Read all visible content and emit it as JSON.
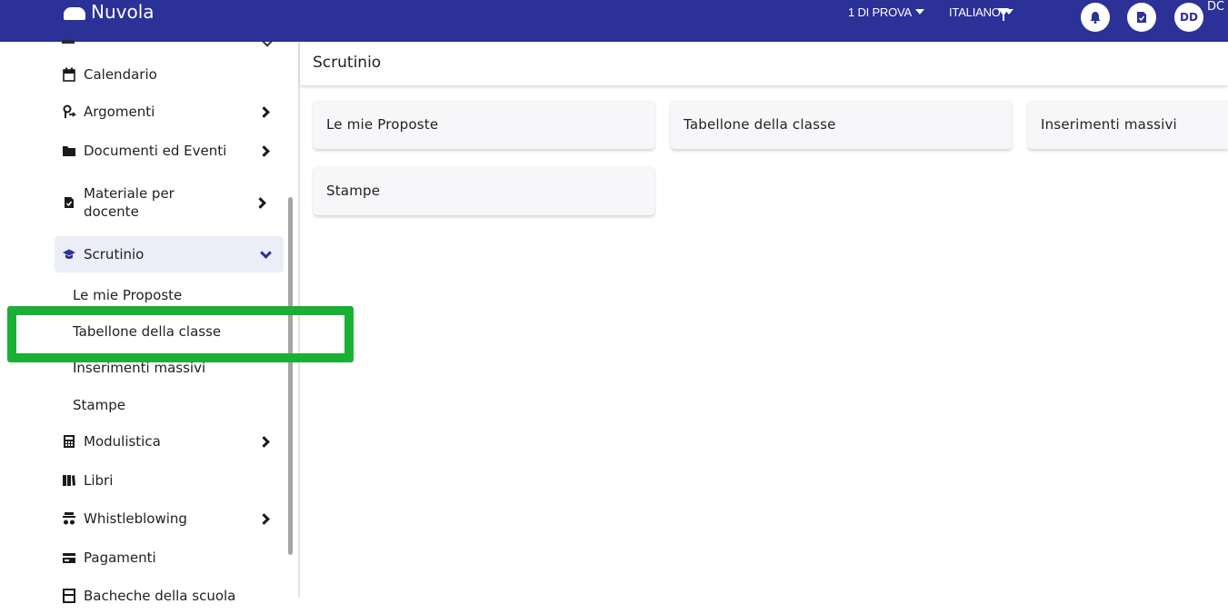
{
  "topbar": {
    "app_name": "Nuvola",
    "class_selector": "1 DI PROVA",
    "language_selector": "ITALIANO",
    "avatar_initials": "DD",
    "user_text": "DC",
    "bg_color": "#2b3196"
  },
  "sidebar": {
    "items": [
      {
        "label": "Calendario",
        "icon": "calendar-icon",
        "has_chevron": false
      },
      {
        "label": "Argomenti",
        "icon": "argomenti-icon",
        "has_chevron": true
      },
      {
        "label": "Documenti ed Eventi",
        "icon": "folder-icon",
        "has_chevron": true
      },
      {
        "label": "Materiale per docente",
        "icon": "document-icon",
        "has_chevron": true
      },
      {
        "label": "Scrutinio",
        "icon": "graduation-cap-icon",
        "has_chevron": true,
        "expanded": true
      },
      {
        "label": "Modulistica",
        "icon": "calculator-icon",
        "has_chevron": true
      },
      {
        "label": "Libri",
        "icon": "books-icon",
        "has_chevron": false
      },
      {
        "label": "Whistleblowing",
        "icon": "whistleblowing-icon",
        "has_chevron": true
      },
      {
        "label": "Pagamenti",
        "icon": "payment-card-icon",
        "has_chevron": false
      },
      {
        "label": "Bacheche della scuola",
        "icon": "board-icon",
        "has_chevron": false
      }
    ],
    "scrutinio_subitems": [
      "Le mie Proposte",
      "Tabellone della classe",
      "Inserimenti massivi",
      "Stampe"
    ]
  },
  "main": {
    "title": "Scrutinio",
    "cards": [
      "Le mie Proposte",
      "Tabellone della classe",
      "Inserimenti massivi",
      "Stampe"
    ]
  },
  "highlight_color": "#19b035"
}
